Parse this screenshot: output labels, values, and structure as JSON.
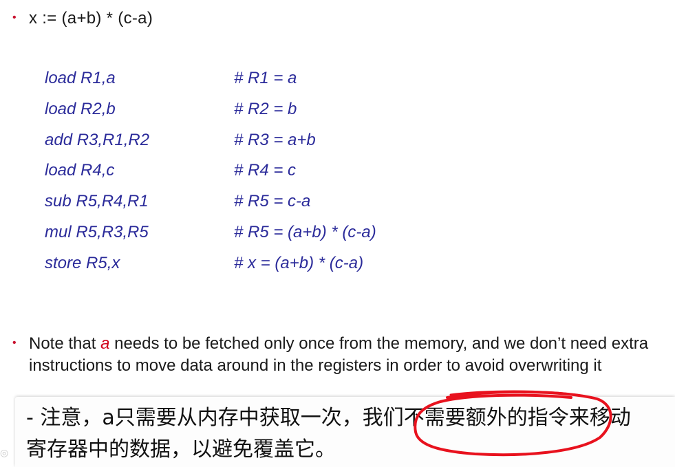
{
  "slide": {
    "title_bullet": "x := (a+b) * (c-a)",
    "code": [
      {
        "instr": "load R1,a",
        "comment": "# R1 = a"
      },
      {
        "instr": "load R2,b",
        "comment": "# R2 = b"
      },
      {
        "instr": "add R3,R1,R2",
        "comment": "# R3 = a+b"
      },
      {
        "instr": "load R4,c",
        "comment": "# R4 = c"
      },
      {
        "instr": "sub R5,R4,R1",
        "comment": "# R5 = c-a"
      },
      {
        "instr": "mul R5,R3,R5",
        "comment": "# R5 = (a+b) * (c-a)"
      },
      {
        "instr": "store R5,x",
        "comment": "# x = (a+b) * (c-a)"
      }
    ],
    "note": {
      "prefix": "Note that ",
      "highlight": "a",
      "suffix": " needs to be fetched only once from the memory, and we don’t need extra instructions to move data around in the registers in order to avoid overwriting it"
    }
  },
  "subtitle": {
    "line1": "- 注意，a只需要从内存中获取一次，我们不需要额外的指令来移动",
    "line2": "寄存器中的数据，以避免覆盖它。"
  },
  "colors": {
    "bullet": "#c8102e",
    "code": "#2b2b9a",
    "highlight": "#d0021b",
    "annotation": "#e8121e"
  }
}
